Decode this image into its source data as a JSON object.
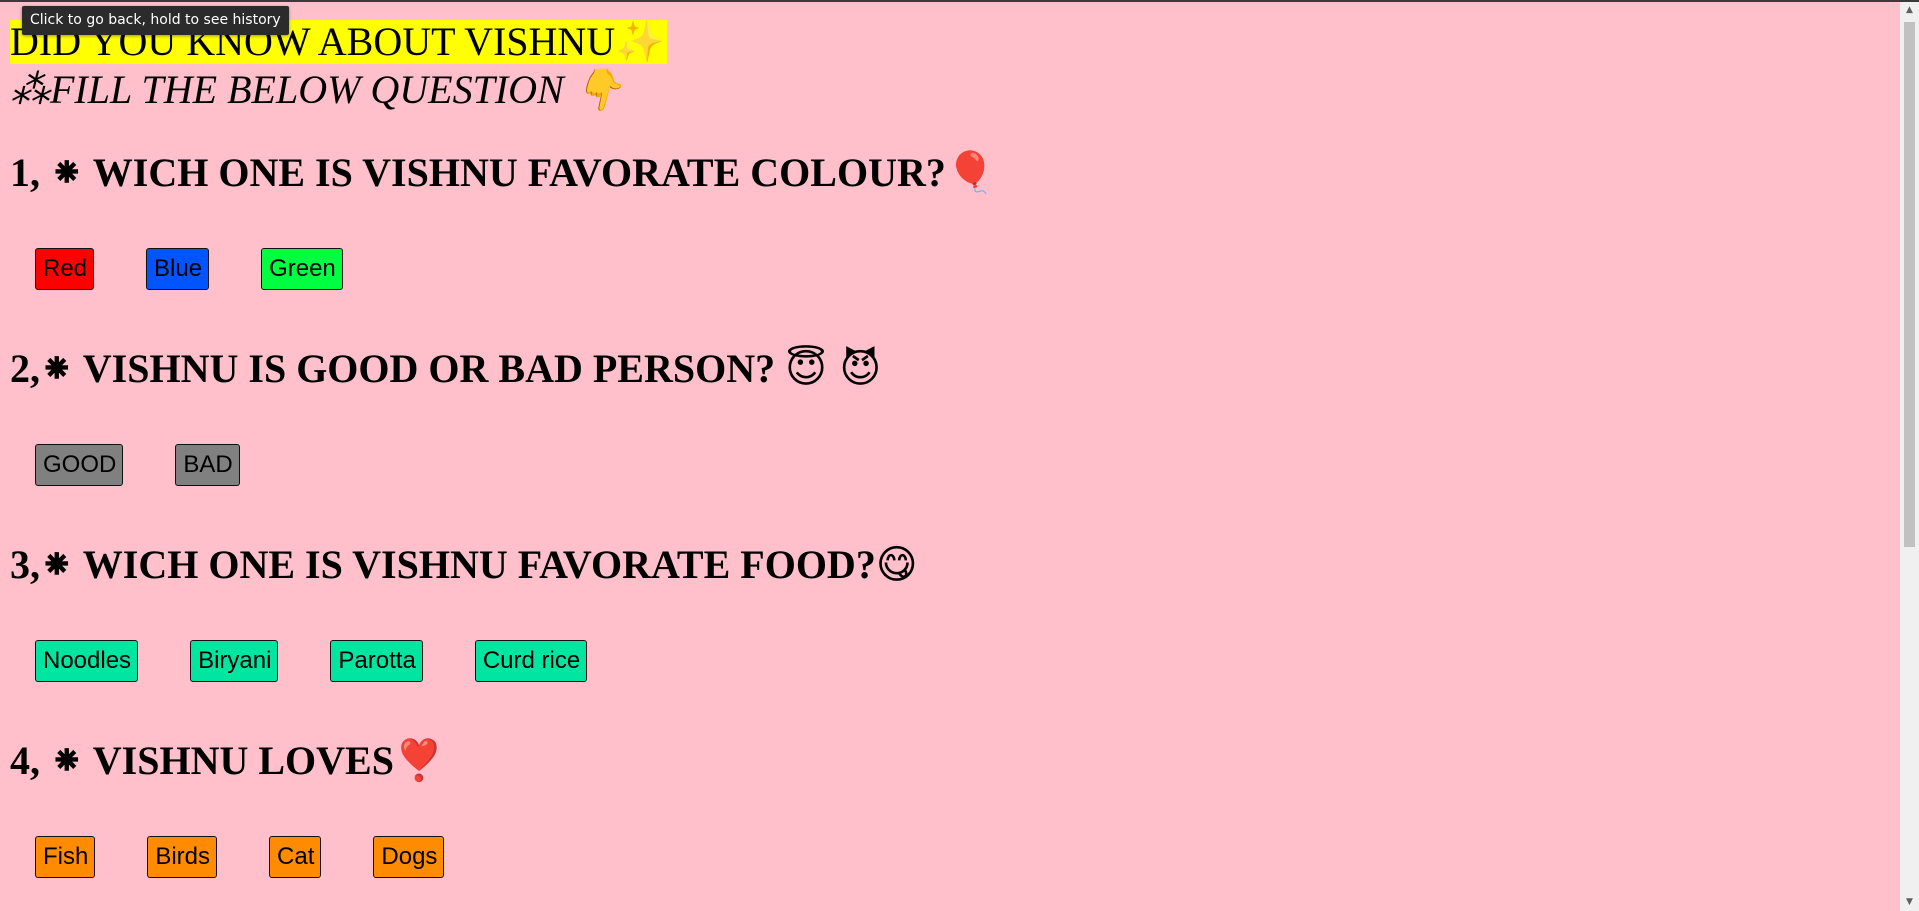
{
  "tooltip": "Click to go back, hold to see history",
  "title": "DID YOU KNOW ABOUT VISHNU",
  "title_emoji": "✨",
  "subtitle": "⁂FILL THE BELOW QUESTION",
  "subtitle_emoji": "👇",
  "questions": [
    {
      "text": "1, ⁕ WICH ONE IS VISHNU FAVORATE COLOUR?",
      "emoji": "🎈",
      "options": [
        {
          "label": "Red",
          "color": "#ff0000"
        },
        {
          "label": "Blue",
          "color": "#0055ff"
        },
        {
          "label": "Green",
          "color": "#00ff40"
        }
      ]
    },
    {
      "text": "2,⁕ VISHNU IS GOOD OR BAD PERSON?",
      "emoji": "😇 😈",
      "options": [
        {
          "label": "GOOD",
          "color": "#808080"
        },
        {
          "label": "BAD",
          "color": "#808080"
        }
      ]
    },
    {
      "text": "3,⁕ WICH ONE IS VISHNU FAVORATE FOOD?",
      "emoji": "😋",
      "options": [
        {
          "label": "Noodles",
          "color": "#00e5a0"
        },
        {
          "label": "Biryani",
          "color": "#00e5a0"
        },
        {
          "label": "Parotta",
          "color": "#00e5a0"
        },
        {
          "label": "Curd rice",
          "color": "#00e5a0"
        }
      ]
    },
    {
      "text": "4, ⁕ VISHNU LOVES",
      "emoji": "❣️",
      "options": [
        {
          "label": "Fish",
          "color": "#ff8c00"
        },
        {
          "label": "Birds",
          "color": "#ff8c00"
        },
        {
          "label": "Cat",
          "color": "#ff8c00"
        },
        {
          "label": "Dogs",
          "color": "#ff8c00"
        }
      ]
    }
  ],
  "colors": {
    "background": "#ffc0cb",
    "title_highlight": "#ffff00"
  }
}
